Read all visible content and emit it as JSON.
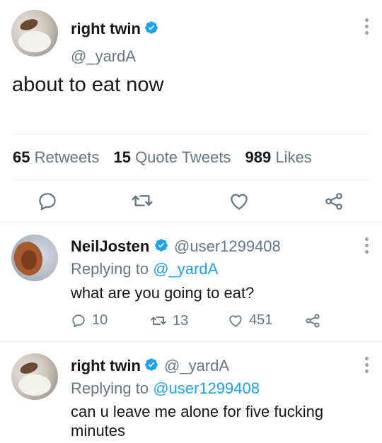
{
  "main_tweet": {
    "name": "right twin",
    "handle": "@_yardA",
    "text": "about to eat now",
    "stats": {
      "retweets_count": "65",
      "retweets_label": "Retweets",
      "quotes_count": "15",
      "quotes_label": "Quote Tweets",
      "likes_count": "989",
      "likes_label": "Likes"
    }
  },
  "replies": [
    {
      "name": "NeilJosten",
      "handle": "@user1299408",
      "replying_prefix": "Replying to",
      "replying_to": "@_yardA",
      "text": "what are you going to eat?",
      "reply_count": "10",
      "retweet_count": "13",
      "like_count": "451"
    },
    {
      "name": "right twin",
      "handle": "@_yardA",
      "replying_prefix": "Replying to",
      "replying_to": "@user1299408",
      "text_line1": "can u leave me alone for five fucking",
      "text_line2": "minutes"
    }
  ],
  "colors": {
    "accent": "#1da1f2",
    "muted": "#657786",
    "text": "#14171a",
    "divider": "#e6ecf0"
  },
  "icons": [
    "verified-icon",
    "more-icon",
    "reply-icon",
    "retweet-icon",
    "like-icon",
    "share-icon"
  ]
}
